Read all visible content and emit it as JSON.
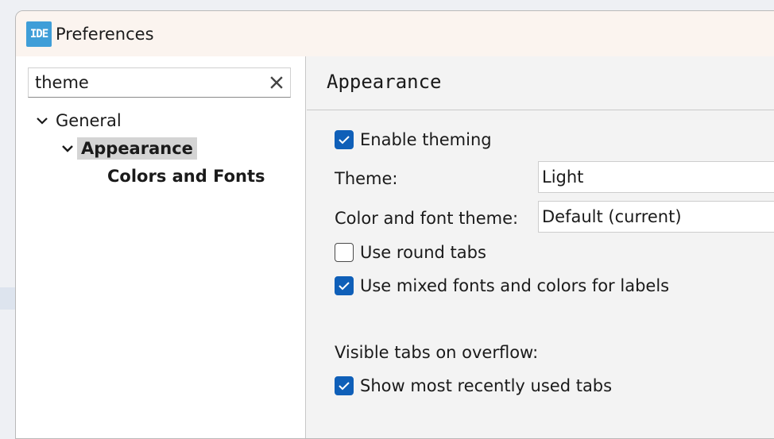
{
  "window": {
    "app_icon_text": "IDE",
    "title": "Preferences"
  },
  "search": {
    "value": "theme",
    "placeholder": ""
  },
  "tree": {
    "items": [
      {
        "label": "General",
        "expanded": true,
        "level": 0
      },
      {
        "label": "Appearance",
        "expanded": true,
        "level": 1,
        "selected": true
      },
      {
        "label": "Colors and Fonts",
        "level": 2
      }
    ]
  },
  "appearance": {
    "title": "Appearance",
    "enable_theming": {
      "label": "Enable theming",
      "checked": true
    },
    "theme": {
      "label": "Theme:",
      "value": "Light"
    },
    "color_font_theme": {
      "label": "Color and font theme:",
      "value": "Default (current)"
    },
    "round_tabs": {
      "label": "Use round tabs",
      "checked": false
    },
    "mixed_fonts": {
      "label": "Use mixed fonts and colors for labels",
      "checked": true
    },
    "visible_tabs_label": "Visible tabs on overflow:",
    "recent_tabs": {
      "label": "Show most recently used tabs",
      "checked": true
    }
  },
  "colors": {
    "accent": "#0f5fb8",
    "icon": "#3f9ed8",
    "titlebar": "#fbf4ef"
  }
}
